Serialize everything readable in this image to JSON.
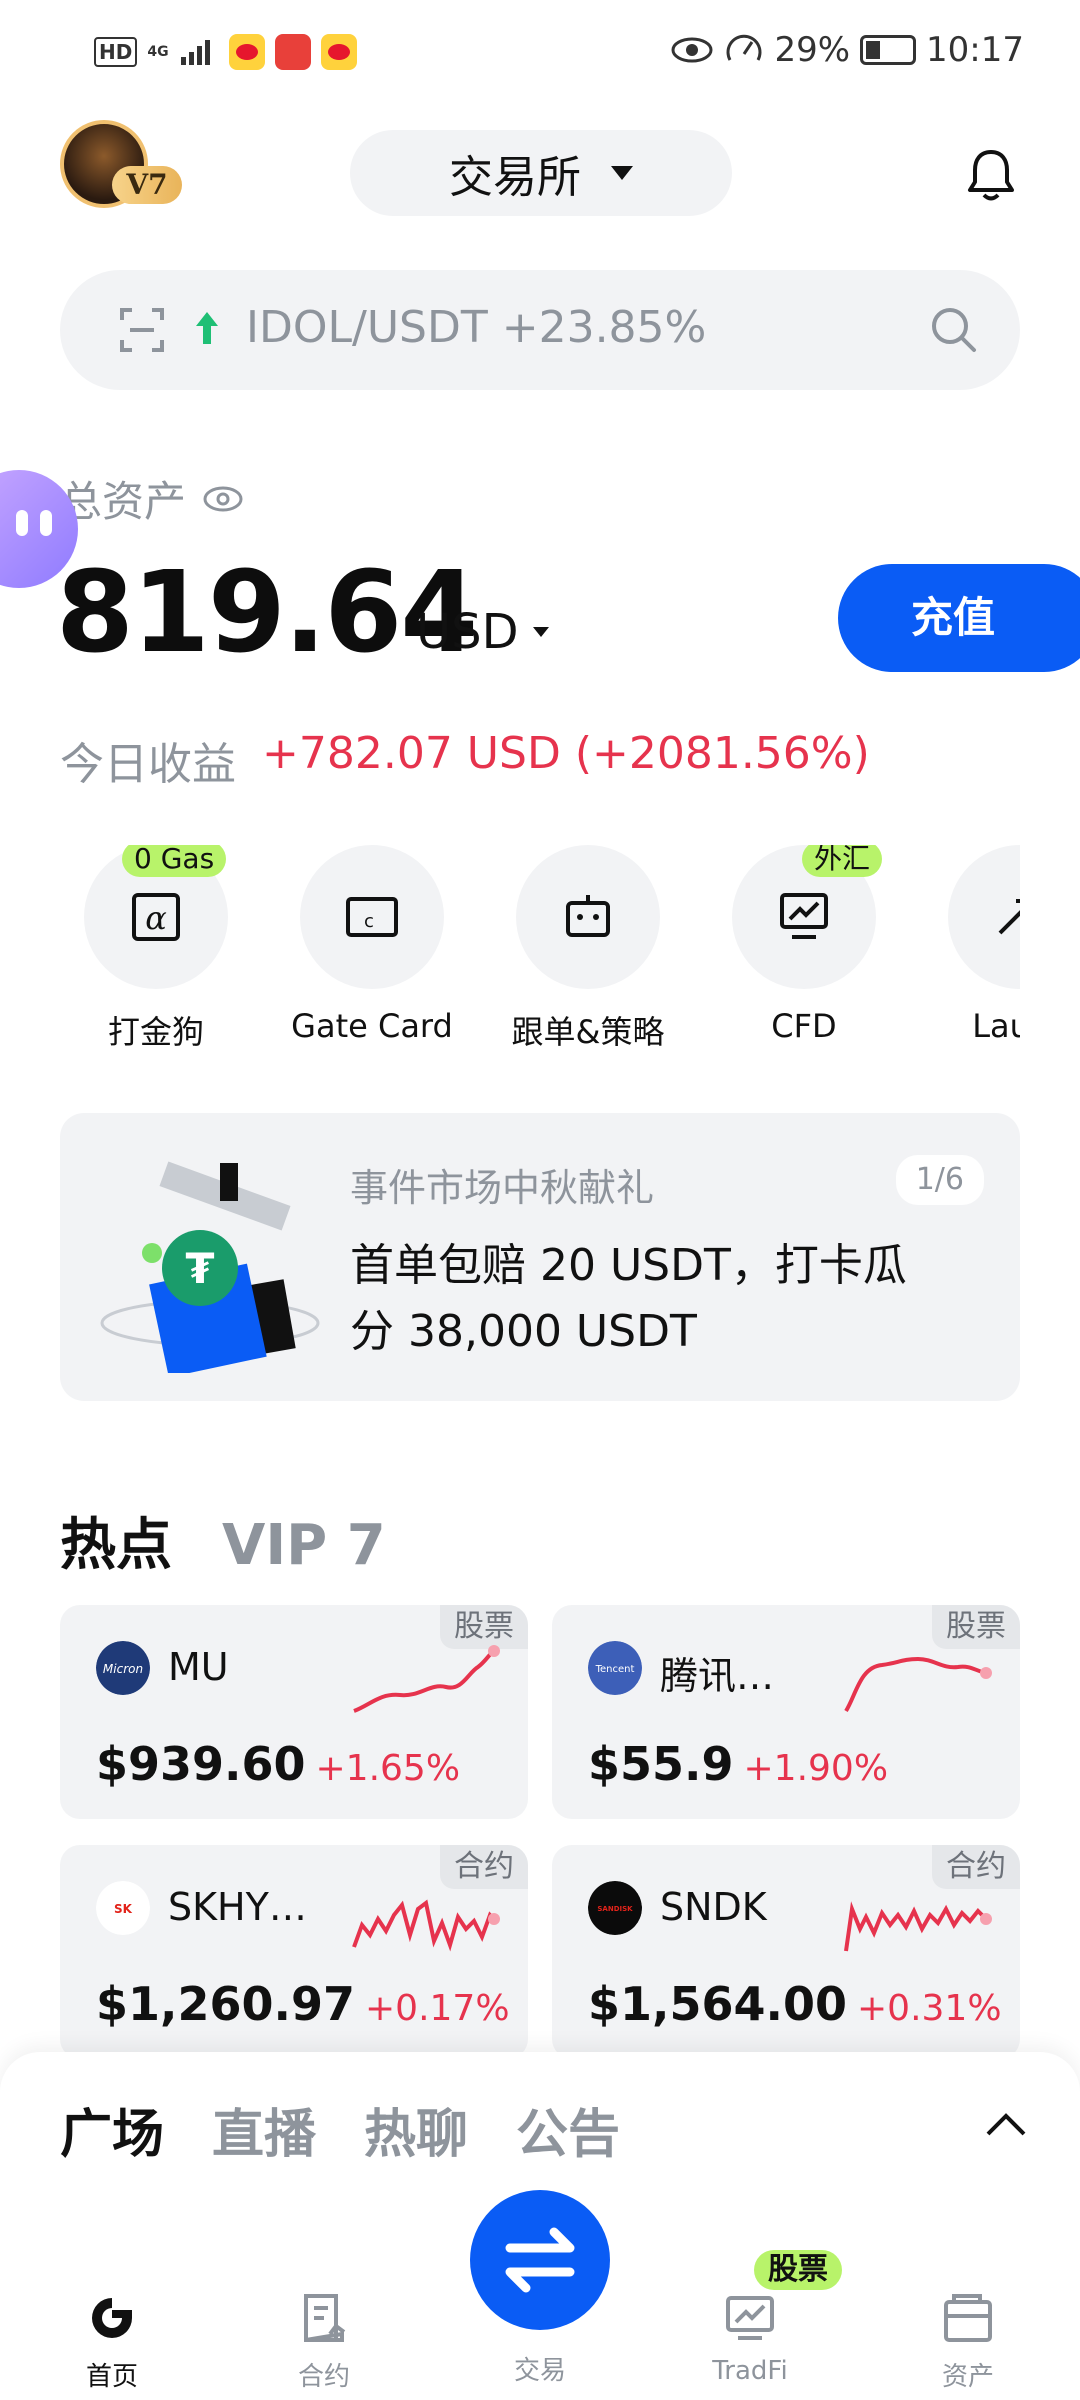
{
  "status_bar": {
    "hd": "HD",
    "network": "4G",
    "battery": "29%",
    "time": "10:17"
  },
  "header": {
    "vip_level": "V7",
    "exchange_label": "交易所"
  },
  "search": {
    "trending_text": "IDOL/USDT +23.85%"
  },
  "assets": {
    "label": "总资产",
    "amount": "819.64",
    "currency": "USD",
    "deposit_label": "充值",
    "pnl_label": "今日收益",
    "pnl_value": "+782.07 USD (+2081.56%)"
  },
  "quick_actions": [
    {
      "label": "打金狗",
      "tag": "0 Gas"
    },
    {
      "label": "Gate Card",
      "tag": ""
    },
    {
      "label": "跟单&策略",
      "tag": ""
    },
    {
      "label": "CFD",
      "tag": "外汇"
    },
    {
      "label": "Launc",
      "tag": ""
    }
  ],
  "banner": {
    "subtitle": "事件市场中秋献礼",
    "title": "首单包赔 20 USDT，打卡瓜分 38,000 USDT",
    "page": "1/6"
  },
  "hot": {
    "tabs": [
      "热点",
      "VIP 7"
    ],
    "cards": [
      {
        "name": "MU",
        "tag": "股票",
        "price": "$939.60",
        "change": "+1.65%",
        "logo": "Micron"
      },
      {
        "name": "腾讯…",
        "tag": "股票",
        "price": "$55.9",
        "change": "+1.90%",
        "logo": "Tencent"
      },
      {
        "name": "SKHY…",
        "tag": "合约",
        "price": "$1,260.97",
        "change": "+0.17%",
        "logo": "SK hynix"
      },
      {
        "name": "SNDK",
        "tag": "合约",
        "price": "$1,564.00",
        "change": "+0.31%",
        "logo": "SANDISK"
      }
    ]
  },
  "feed_tabs": [
    "广场",
    "直播",
    "热聊",
    "公告"
  ],
  "nav": {
    "home": "首页",
    "futures": "合约",
    "trade": "交易",
    "tradfi": "TradFi",
    "tradfi_badge": "股票",
    "assets": "资产"
  },
  "colors": {
    "accent": "#0a5cf5",
    "up": "#e6334d",
    "badge": "#b8f36a"
  }
}
